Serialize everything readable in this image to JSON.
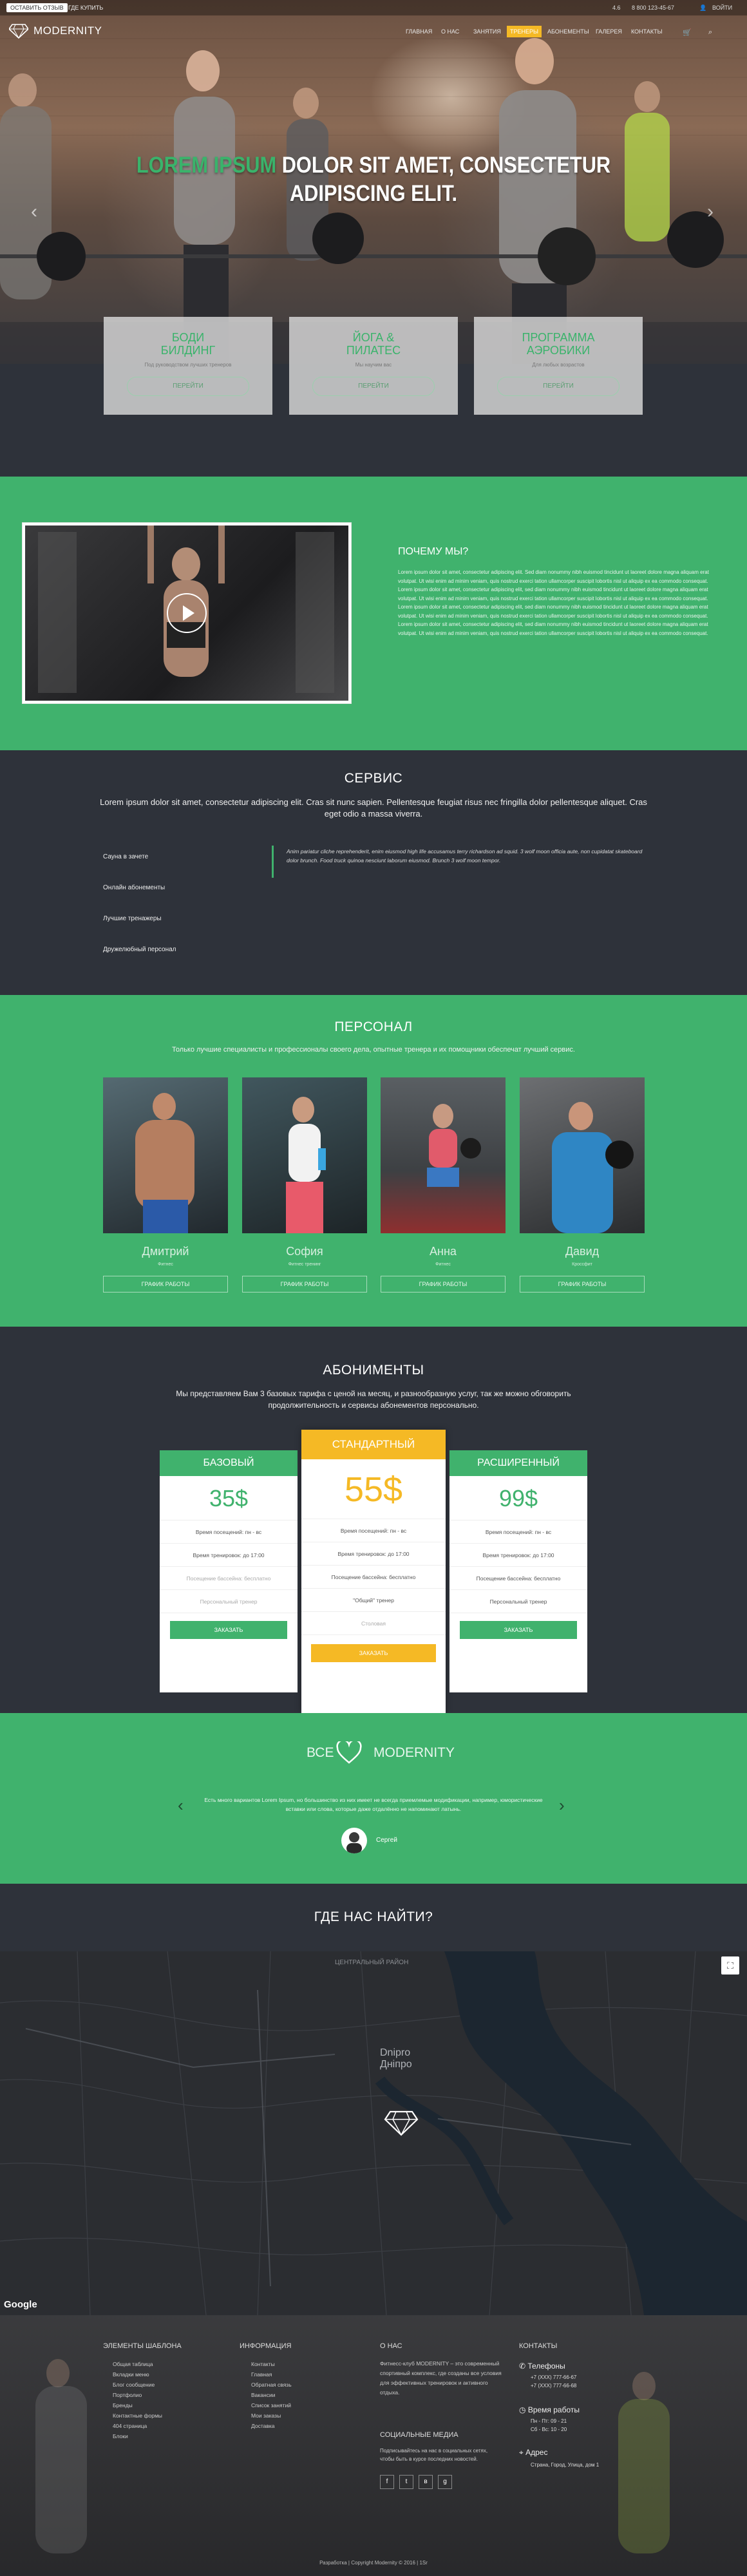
{
  "topbar": {
    "left_primary": "ОСТАВИТЬ ОТЗЫВ",
    "left_secondary": "ГДЕ КУПИТЬ",
    "right_items": [
      "4.6",
      "8 800 123-45-67",
      "ВОЙТИ"
    ]
  },
  "brand": {
    "name": "MODERNITY"
  },
  "nav": {
    "items": [
      "ГЛАВНАЯ",
      "О НАС",
      "ЗАНЯТИЯ",
      "ТРЕНЕРЫ",
      "АБОНЕМЕНТЫ",
      "ГАЛЕРЕЯ",
      "КОНТАКТЫ"
    ]
  },
  "hero": {
    "title_green": "LOREM IPSUM",
    "title_white": " DOLOR SIT AMET, CONSECTETUR ADIPISCING ELIT."
  },
  "cards": [
    {
      "title": "БОДИ\nБИЛДИНГ",
      "text": "Под руководством лучших тренеров",
      "button": "ПЕРЕЙТИ"
    },
    {
      "title": "ЙОГА &\nПИЛАТЕС",
      "text": "Мы научим вас",
      "button": "ПЕРЕЙТИ"
    },
    {
      "title": "ПРОГРАММА\nАЭРОБИКИ",
      "text": "Для любых возрастов",
      "button": "ПЕРЕЙТИ"
    }
  ],
  "why": {
    "title": "ПОЧЕМУ МЫ?",
    "text": "Lorem ipsum dolor sit amet, consectetur adipiscing elit. Sed diam nonummy nibh euismod tincidunt ut laoreet dolore magna aliquam erat volutpat. Ut wisi enim ad minim veniam, quis nostrud exerci tation ullamcorper suscipit lobortis nisl ut aliquip ex ea commodo consequat. Lorem ipsum dolor sit amet, consectetur adipiscing elit, sed diam nonummy nibh euismod tincidunt ut laoreet dolore magna aliquam erat volutpat. Ut wisi enim ad minim veniam, quis nostrud exerci tation ullamcorper suscipit lobortis nisl ut aliquip ex ea commodo consequat. Lorem ipsum dolor sit amet, consectetur adipiscing elit, sed diam nonummy nibh euismod tincidunt ut laoreet dolore magna aliquam erat volutpat. Ut wisi enim ad minim veniam, quis nostrud exerci tation ullamcorper suscipit lobortis nisl ut aliquip ex ea commodo consequat. Lorem ipsum dolor sit amet, consectetur adipiscing elit, sed diam nonummy nibh euismod tincidunt ut laoreet dolore magna aliquam erat volutpat. Ut wisi enim ad minim veniam, quis nostrud exerci tation ullamcorper suscipit lobortis nisl ut aliquip ex ea commodo consequat."
  },
  "service": {
    "title": "СЕРВИС",
    "subtitle": "Lorem ipsum dolor sit amet, consectetur adipiscing elit. Cras sit nunc sapien. Pellentesque feugiat risus nec fringilla dolor pellentesque aliquet. Cras eget odio a massa viverra.",
    "items": [
      "Сауна в зачете",
      "Онлайн абонементы",
      "Лучшие тренажеры",
      "Дружелюбный персонал"
    ],
    "quote": "Anim pariatur cliche reprehenderit, enim eiusmod high life accusamus terry richardson ad squid. 3 wolf moon officia aute, non cupidatat skateboard dolor brunch. Food truck quinoa nesciunt laborum eiusmod. Brunch 3 wolf moon tempor."
  },
  "staff": {
    "title": "ПЕРСОНАЛ",
    "subtitle": "Только лучшие специалисты и профессионалы своего дела, опытные тренера и их помощники обеспечат лучший сервис.",
    "members": [
      {
        "name": "Дмитрий",
        "role": "Фитнес",
        "button": "ГРАФИК РАБОТЫ"
      },
      {
        "name": "София",
        "role": "Фитнес тренинг",
        "button": "ГРАФИК РАБОТЫ"
      },
      {
        "name": "Анна",
        "role": "Фитнес",
        "button": "ГРАФИК РАБОТЫ"
      },
      {
        "name": "Давид",
        "role": "Кроссфит",
        "button": "ГРАФИК РАБОТЫ"
      }
    ]
  },
  "plans": {
    "title": "АБОНИМЕНТЫ",
    "subtitle": "Мы представляем Вам 3 базовых тарифа с ценой на месяц, и разнообразную услуг, так же можно обговорить продолжительность и сервисы абонементов персонально.",
    "items": [
      {
        "name": "БАЗОВЫЙ",
        "price": "35$",
        "features": [
          "Время посещений: пн - вс",
          "Время тренировок: до 17:00",
          "Посещение бассейна: бесплатно",
          "Персональный тренер"
        ],
        "button": "ЗАКАЗАТЬ"
      },
      {
        "name": "СТАНДАРТНЫЙ",
        "price": "55$",
        "features": [
          "Время посещений: пн - вс",
          "Время тренировок: до 17:00",
          "Посещение бассейна: бесплатно",
          "\"Общий\" тренер",
          "Столовая"
        ],
        "button": "ЗАКАЗАТЬ"
      },
      {
        "name": "РАСШИРЕННЫЙ",
        "price": "99$",
        "features": [
          "Время посещений: пн - вс",
          "Время тренировок: до 17:00",
          "Посещение бассейна: бесплатно",
          "Персональный тренер"
        ],
        "button": "ЗАКАЗАТЬ"
      }
    ]
  },
  "love": {
    "left": "ВСЕ",
    "right": "MODERNITY",
    "quote": "Есть много вариантов Lorem Ipsum, но большинство из них имеет не всегда приемлемые модификации, например, юмористические вставки или слова, которые даже отдалённо не напоминают латынь.",
    "author": "Сергей"
  },
  "map": {
    "title": "ГДЕ НАС НАЙТИ?",
    "labels": [
      "Dnipro",
      "Дніпро",
      "ЦЕНТРАЛЬНЫЙ РАЙОН"
    ],
    "google": "Google"
  },
  "footer": {
    "cols": [
      {
        "title": "ЭЛЕМЕНТЫ ШАБЛОНА",
        "items": [
          "Общая таблица",
          "Вкладки меню",
          "Блог сообщение",
          "Портфолио",
          "Бренды",
          "Контактные формы",
          "404 страница",
          "Блоки"
        ]
      },
      {
        "title": "ИНФОРМАЦИЯ",
        "items": [
          "Контакты",
          "Главная",
          "Обратная связь",
          "Вакансии",
          "Список занятий",
          "Мои заказы",
          "Доставка"
        ]
      },
      {
        "title": "О НАС",
        "text": "Фитнесс-клуб MODERNITY – это современный спортивный комплекс, где созданы все условия для эффективных тренировок и активного отдыха."
      }
    ],
    "social_title": "СОЦИАЛЬНЫЕ МЕДИА",
    "social_text": "Подписывайтесь на нас в социальных сетях, чтобы быть в курсе последних новостей.",
    "contacts": {
      "title": "КОНТАКТЫ",
      "phones_label": "Телефоны",
      "phones": [
        "+7 (XXX) 777-66-67",
        "+7 (XXX) 777-66-68"
      ],
      "hours_label": "Время работы",
      "hours": [
        "Пн - Пт: 09 - 21",
        "Сб - Вс: 10 - 20"
      ],
      "address_label": "Адрес",
      "address": "Страна, Город, Улица, дом 1"
    },
    "copyright": "Разработка | Copyright Modernity © 2016 | 1Sr"
  },
  "colors": {
    "accent": "#40b26d",
    "dark": "#2e323a",
    "highlight": "#f5b925"
  }
}
